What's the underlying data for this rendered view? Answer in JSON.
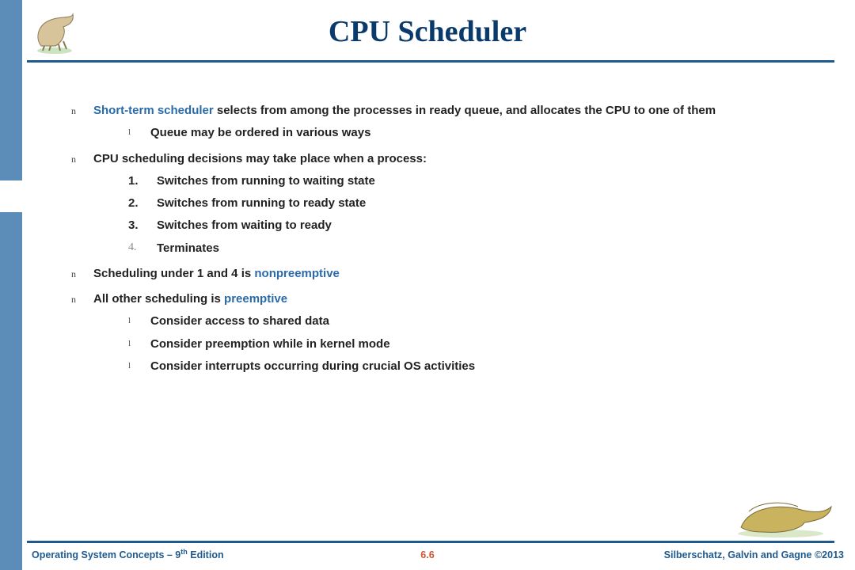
{
  "title": "CPU Scheduler",
  "bullets": {
    "b1_prefix": "Short-term scheduler",
    "b1_rest": " selects from among the processes in ready queue, and allocates the CPU to one of them",
    "b1_sub1": "Queue may be ordered in various ways",
    "b2": "CPU scheduling decisions may take place when a process:",
    "n1": "1.",
    "n1_text": "Switches from running to waiting state",
    "n2": "2.",
    "n2_text": "Switches from running to ready state",
    "n3": "3.",
    "n3_text": "Switches from waiting to ready",
    "n4": "4.",
    "n4_text": "Terminates",
    "b3_pre": "Scheduling under 1 and 4 is ",
    "b3_kw": "nonpreemptive",
    "b4_pre": "All other scheduling is ",
    "b4_kw": "preemptive",
    "b4_sub1": "Consider access to shared data",
    "b4_sub2": "Consider preemption while in kernel mode",
    "b4_sub3": "Consider interrupts occurring during crucial OS activities"
  },
  "footer": {
    "left_pre": "Operating System Concepts – 9",
    "left_sup": "th",
    "left_post": " Edition",
    "center": "6.6",
    "right": "Silberschatz, Galvin and Gagne ©2013"
  }
}
